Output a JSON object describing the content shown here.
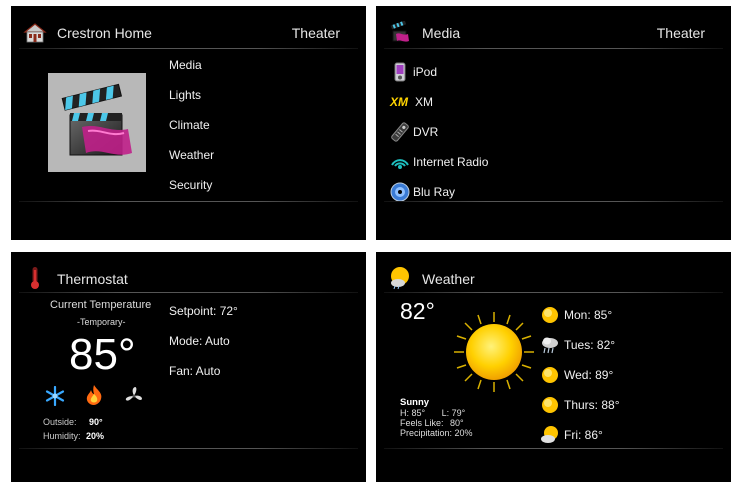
{
  "home": {
    "title": "Crestron Home",
    "room": "Theater",
    "menu": [
      "Media",
      "Lights",
      "Climate",
      "Weather",
      "Security"
    ]
  },
  "media": {
    "title": "Media",
    "room": "Theater",
    "sources": [
      {
        "label": "iPod",
        "icon": "ipod-icon"
      },
      {
        "label": "XM",
        "icon": "xm-logo-icon",
        "logo_text": "XM"
      },
      {
        "label": "DVR",
        "icon": "dvr-remote-icon"
      },
      {
        "label": "Internet Radio",
        "icon": "internet-radio-icon"
      },
      {
        "label": "Blu Ray",
        "icon": "bluray-disc-icon"
      }
    ]
  },
  "thermostat": {
    "title": "Thermostat",
    "current_label": "Current Temperature",
    "mode_note": "-Temporary-",
    "current_temp": "85°",
    "outside_label": "Outside:",
    "outside_value": "90°",
    "humidity_label": "Humidity:",
    "humidity_value": "20%",
    "setpoint": "Setpoint: 72°",
    "mode": "Mode: Auto",
    "fan": "Fan: Auto",
    "controls": [
      "snowflake-icon",
      "flame-icon",
      "fan-icon"
    ]
  },
  "weather": {
    "title": "Weather",
    "current_temp": "82°",
    "condition": "Sunny",
    "high": "H: 85°",
    "low": "L: 79°",
    "feels_label": "Feels Like:",
    "feels_value": "80°",
    "precip_label": "Precipitation:",
    "precip_value": "20%",
    "forecast": [
      {
        "label": "Mon: 85°",
        "icon": "sun-icon"
      },
      {
        "label": "Tues: 82°",
        "icon": "storm-cloud-icon"
      },
      {
        "label": "Wed: 89°",
        "icon": "sun-icon"
      },
      {
        "label": "Thurs: 88°",
        "icon": "sun-icon"
      },
      {
        "label": "Fri: 86°",
        "icon": "partly-cloudy-icon"
      }
    ]
  },
  "colors": {
    "panel_bg": "#000000",
    "text": "#f0f0f0",
    "accent_yellow": "#ffd400"
  }
}
